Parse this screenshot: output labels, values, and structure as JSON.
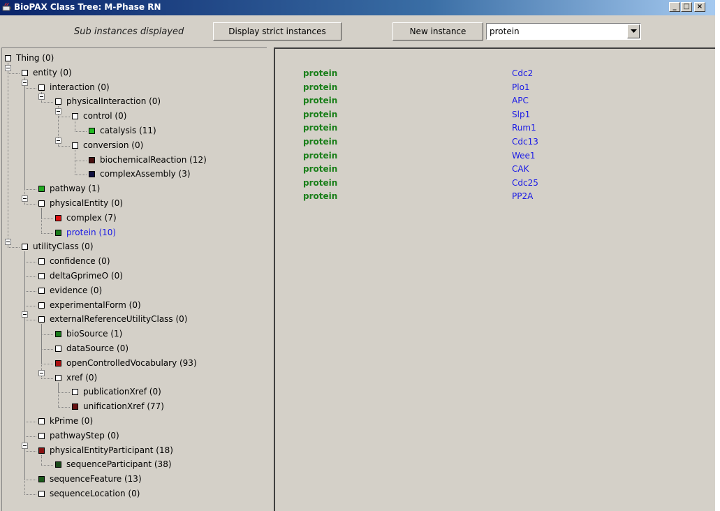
{
  "window": {
    "title": "BioPAX Class Tree: M-Phase RN",
    "controls": {
      "minimize": "_",
      "maximize": "□",
      "close": "×"
    }
  },
  "toolbar": {
    "status": "Sub instances displayed",
    "strict_button": "Display strict instances",
    "new_instance_button": "New instance",
    "class_combo_value": "protein"
  },
  "tree": [
    {
      "label": "Thing (0)",
      "color": "#ffffff"
    },
    {
      "label": "entity (0)",
      "color": "#ffffff"
    },
    {
      "label": "interaction (0)",
      "color": "#ffffff"
    },
    {
      "label": "physicalInteraction (0)",
      "color": "#ffffff"
    },
    {
      "label": "control (0)",
      "color": "#ffffff"
    },
    {
      "label": "catalysis (11)",
      "color": "#22bb22"
    },
    {
      "label": "conversion (0)",
      "color": "#ffffff"
    },
    {
      "label": "biochemicalReaction (12)",
      "color": "#4a1010"
    },
    {
      "label": "complexAssembly (3)",
      "color": "#101040"
    },
    {
      "label": "pathway (1)",
      "color": "#22aa22"
    },
    {
      "label": "physicalEntity (0)",
      "color": "#ffffff"
    },
    {
      "label": "complex (7)",
      "color": "#dd1111"
    },
    {
      "label": "protein (10)",
      "color": "#1a7a1a",
      "selected": true
    },
    {
      "label": "utilityClass (0)",
      "color": "#ffffff"
    },
    {
      "label": "confidence (0)",
      "color": "#ffffff"
    },
    {
      "label": "deltaGprimeO (0)",
      "color": "#ffffff"
    },
    {
      "label": "evidence (0)",
      "color": "#ffffff"
    },
    {
      "label": "experimentalForm (0)",
      "color": "#ffffff"
    },
    {
      "label": "externalReferenceUtilityClass (0)",
      "color": "#ffffff"
    },
    {
      "label": "bioSource (1)",
      "color": "#1a7a1a"
    },
    {
      "label": "dataSource (0)",
      "color": "#ffffff"
    },
    {
      "label": "openControlledVocabulary (93)",
      "color": "#aa1111"
    },
    {
      "label": "xref (0)",
      "color": "#ffffff"
    },
    {
      "label": "publicationXref (0)",
      "color": "#ffffff"
    },
    {
      "label": "unificationXref (77)",
      "color": "#661111"
    },
    {
      "label": "kPrime (0)",
      "color": "#ffffff"
    },
    {
      "label": "pathwayStep (0)",
      "color": "#ffffff"
    },
    {
      "label": "physicalEntityParticipant (18)",
      "color": "#881111"
    },
    {
      "label": "sequenceParticipant (38)",
      "color": "#1a4a1a"
    },
    {
      "label": "sequenceFeature (13)",
      "color": "#1a5a1a"
    },
    {
      "label": "sequenceLocation (0)",
      "color": "#ffffff"
    }
  ],
  "instances": [
    {
      "cls": "protein",
      "name": "Cdc2"
    },
    {
      "cls": "protein",
      "name": "Plo1"
    },
    {
      "cls": "protein",
      "name": "APC"
    },
    {
      "cls": "protein",
      "name": "Slp1"
    },
    {
      "cls": "protein",
      "name": "Rum1"
    },
    {
      "cls": "protein",
      "name": "Cdc13"
    },
    {
      "cls": "protein",
      "name": "Wee1"
    },
    {
      "cls": "protein",
      "name": "CAK"
    },
    {
      "cls": "protein",
      "name": "Cdc25"
    },
    {
      "cls": "protein",
      "name": "PP2A"
    }
  ],
  "colors": {
    "titlebar_start": "#0a246a",
    "window_bg": "#d4d0c8",
    "instance_class": "#1a7f1a",
    "instance_name": "#1a1ae6"
  }
}
